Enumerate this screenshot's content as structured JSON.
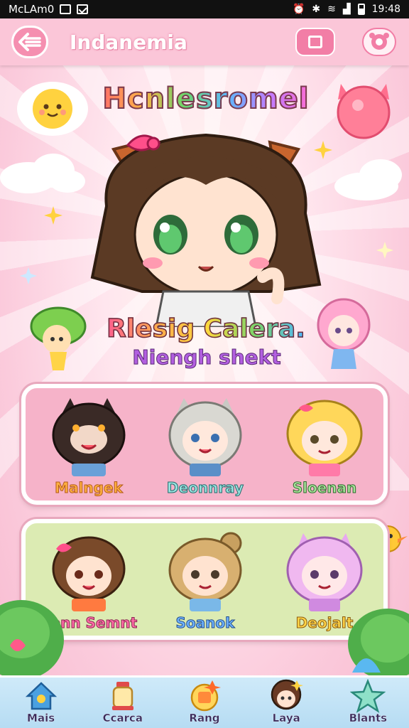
{
  "status_bar": {
    "carrier": "McLAm0",
    "time": "19:48"
  },
  "header": {
    "title": "Indanemia"
  },
  "hero": {
    "title": "Hcnlesromel",
    "subtitle_1": "Rlesig Calera.",
    "subtitle_2": "Niengh shekt"
  },
  "panels": [
    {
      "name": "pink",
      "characters": [
        {
          "name": "Malngek"
        },
        {
          "name": "Deonnray"
        },
        {
          "name": "Sloenan"
        }
      ]
    },
    {
      "name": "green",
      "characters": [
        {
          "name": "Cenn Semnt"
        },
        {
          "name": "Soanok"
        },
        {
          "name": "Deojalt"
        }
      ]
    }
  ],
  "bottom_nav": [
    {
      "label": "Mais",
      "icon": "home-icon"
    },
    {
      "label": "Ccarca",
      "icon": "lantern-icon"
    },
    {
      "label": "Rang",
      "icon": "badge-icon"
    },
    {
      "label": "Laya",
      "icon": "avatar-icon"
    },
    {
      "label": "Blants",
      "icon": "star-icon"
    }
  ],
  "colors": {
    "header": "#fbc6d8",
    "accent": "#f27ea6",
    "panel_pink": "#f6b3c9",
    "panel_green": "#dcebb3",
    "nav": "#cfeaf9"
  }
}
